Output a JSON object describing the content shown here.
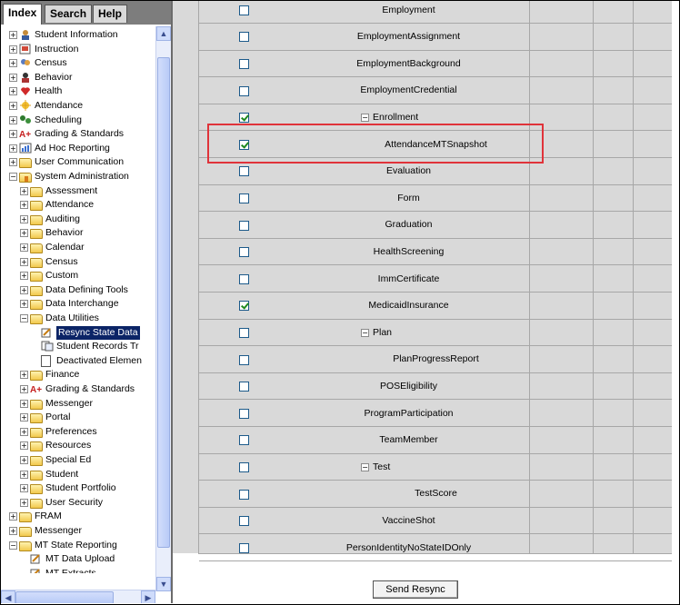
{
  "tabs": [
    {
      "label": "Index",
      "active": true
    },
    {
      "label": "Search",
      "active": false
    },
    {
      "label": "Help",
      "active": false
    }
  ],
  "tree": [
    {
      "label": "Student Information",
      "level": 0,
      "expander": "+",
      "icon": "student-info-icon"
    },
    {
      "label": "Instruction",
      "level": 0,
      "expander": "+",
      "icon": "instruction-icon"
    },
    {
      "label": "Census",
      "level": 0,
      "expander": "+",
      "icon": "census-icon"
    },
    {
      "label": "Behavior",
      "level": 0,
      "expander": "+",
      "icon": "behavior-icon"
    },
    {
      "label": "Health",
      "level": 0,
      "expander": "+",
      "icon": "health-icon"
    },
    {
      "label": "Attendance",
      "level": 0,
      "expander": "+",
      "icon": "attendance-icon"
    },
    {
      "label": "Scheduling",
      "level": 0,
      "expander": "+",
      "icon": "scheduling-icon"
    },
    {
      "label": "Grading & Standards",
      "level": 0,
      "expander": "+",
      "icon": "grading-icon"
    },
    {
      "label": "Ad Hoc Reporting",
      "level": 0,
      "expander": "+",
      "icon": "ad-hoc-icon"
    },
    {
      "label": "User Communication",
      "level": 0,
      "expander": "+",
      "icon": "folder-icon"
    },
    {
      "label": "System Administration",
      "level": 0,
      "expander": "−",
      "icon": "system-admin-icon"
    },
    {
      "label": "Assessment",
      "level": 1,
      "expander": "+",
      "icon": "folder-icon"
    },
    {
      "label": "Attendance",
      "level": 1,
      "expander": "+",
      "icon": "folder-icon"
    },
    {
      "label": "Auditing",
      "level": 1,
      "expander": "+",
      "icon": "folder-icon"
    },
    {
      "label": "Behavior",
      "level": 1,
      "expander": "+",
      "icon": "folder-icon"
    },
    {
      "label": "Calendar",
      "level": 1,
      "expander": "+",
      "icon": "folder-icon"
    },
    {
      "label": "Census",
      "level": 1,
      "expander": "+",
      "icon": "folder-icon"
    },
    {
      "label": "Custom",
      "level": 1,
      "expander": "+",
      "icon": "folder-icon"
    },
    {
      "label": "Data Defining Tools",
      "level": 1,
      "expander": "+",
      "icon": "folder-icon"
    },
    {
      "label": "Data Interchange",
      "level": 1,
      "expander": "+",
      "icon": "folder-icon"
    },
    {
      "label": "Data Utilities",
      "level": 1,
      "expander": "−",
      "icon": "folder-icon"
    },
    {
      "label": "Resync State Data",
      "level": 2,
      "expander": "",
      "icon": "tool-icon",
      "selected": true
    },
    {
      "label": "Student Records Tr",
      "level": 2,
      "expander": "",
      "icon": "records-icon"
    },
    {
      "label": "Deactivated Elemen",
      "level": 2,
      "expander": "",
      "icon": "document-icon"
    },
    {
      "label": "Finance",
      "level": 1,
      "expander": "+",
      "icon": "folder-icon"
    },
    {
      "label": "Grading & Standards",
      "level": 1,
      "expander": "+",
      "icon": "grading-icon"
    },
    {
      "label": "Messenger",
      "level": 1,
      "expander": "+",
      "icon": "folder-icon"
    },
    {
      "label": "Portal",
      "level": 1,
      "expander": "+",
      "icon": "folder-icon"
    },
    {
      "label": "Preferences",
      "level": 1,
      "expander": "+",
      "icon": "folder-icon"
    },
    {
      "label": "Resources",
      "level": 1,
      "expander": "+",
      "icon": "folder-icon"
    },
    {
      "label": "Special Ed",
      "level": 1,
      "expander": "+",
      "icon": "folder-icon"
    },
    {
      "label": "Student",
      "level": 1,
      "expander": "+",
      "icon": "folder-icon"
    },
    {
      "label": "Student Portfolio",
      "level": 1,
      "expander": "+",
      "icon": "folder-icon"
    },
    {
      "label": "User Security",
      "level": 1,
      "expander": "+",
      "icon": "folder-icon"
    },
    {
      "label": "FRAM",
      "level": 0,
      "expander": "+",
      "icon": "folder-icon"
    },
    {
      "label": "Messenger",
      "level": 0,
      "expander": "+",
      "icon": "folder-icon"
    },
    {
      "label": "MT State Reporting",
      "level": 0,
      "expander": "−",
      "icon": "folder-icon"
    },
    {
      "label": "MT Data Upload",
      "level": 1,
      "expander": "",
      "icon": "tool-icon"
    },
    {
      "label": "MT Extracts",
      "level": 1,
      "expander": "",
      "icon": "tool-icon"
    }
  ],
  "table": {
    "rows": [
      {
        "label": "Employment",
        "checked": false,
        "indent": 0,
        "expander": ""
      },
      {
        "label": "EmploymentAssignment",
        "checked": false,
        "indent": 0,
        "expander": ""
      },
      {
        "label": "EmploymentBackground",
        "checked": false,
        "indent": 0,
        "expander": ""
      },
      {
        "label": "EmploymentCredential",
        "checked": false,
        "indent": 0,
        "expander": ""
      },
      {
        "label": "Enrollment",
        "checked": true,
        "indent": 0,
        "expander": "−"
      },
      {
        "label": "AttendanceMTSnapshot",
        "checked": true,
        "indent": 1,
        "expander": ""
      },
      {
        "label": "Evaluation",
        "checked": false,
        "indent": 0,
        "expander": ""
      },
      {
        "label": "Form",
        "checked": false,
        "indent": 0,
        "expander": ""
      },
      {
        "label": "Graduation",
        "checked": false,
        "indent": 0,
        "expander": ""
      },
      {
        "label": "HealthScreening",
        "checked": false,
        "indent": 0,
        "expander": ""
      },
      {
        "label": "ImmCertificate",
        "checked": false,
        "indent": 0,
        "expander": ""
      },
      {
        "label": "MedicaidInsurance",
        "checked": true,
        "indent": 0,
        "expander": ""
      },
      {
        "label": "Plan",
        "checked": false,
        "indent": 0,
        "expander": "−"
      },
      {
        "label": "PlanProgressReport",
        "checked": false,
        "indent": 1,
        "expander": ""
      },
      {
        "label": "POSEligibility",
        "checked": false,
        "indent": 0,
        "expander": ""
      },
      {
        "label": "ProgramParticipation",
        "checked": false,
        "indent": 0,
        "expander": ""
      },
      {
        "label": "TeamMember",
        "checked": false,
        "indent": 0,
        "expander": ""
      },
      {
        "label": "Test",
        "checked": false,
        "indent": 0,
        "expander": "−"
      },
      {
        "label": "TestScore",
        "checked": false,
        "indent": 1,
        "expander": ""
      },
      {
        "label": "VaccineShot",
        "checked": false,
        "indent": 0,
        "expander": ""
      },
      {
        "label": "PersonIdentityNoStateIDOnly",
        "checked": false,
        "indent": 0,
        "expander": ""
      }
    ]
  },
  "send_button": {
    "label": "Send Resync"
  },
  "colors": {
    "selection": "#0b2466",
    "highlight_box": "#e0333a",
    "panel_bg": "#d9d9d9"
  }
}
